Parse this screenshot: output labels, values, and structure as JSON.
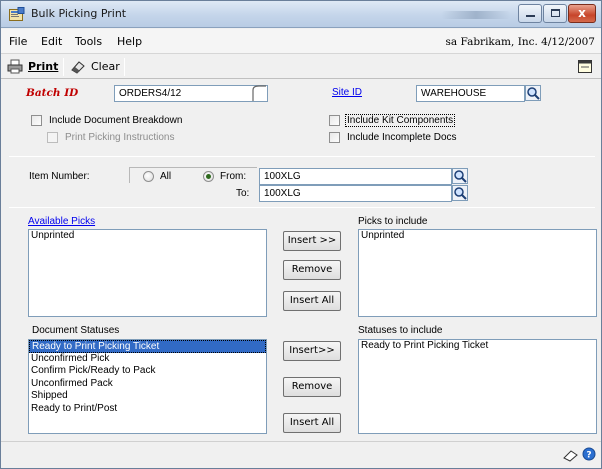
{
  "window": {
    "title": "Bulk Picking Print",
    "controls": [
      "minimize",
      "maximize",
      "close"
    ]
  },
  "menu": {
    "items": [
      "File",
      "Edit",
      "Tools",
      "Help"
    ],
    "context": "sa  Fabrikam, Inc.  4/12/2007"
  },
  "toolbar": {
    "print_label": "Print",
    "clear_label": "Clear"
  },
  "batch": {
    "label": "Batch ID",
    "value": "ORDERS4/12"
  },
  "site": {
    "label": "Site ID",
    "value": "WAREHOUSE"
  },
  "options": {
    "include_doc_breakdown": "Include Document Breakdown",
    "print_picking_instructions": "Print Picking Instructions",
    "include_kit_components": "Include Kit Components",
    "include_incomplete_docs": "Include Incomplete Docs"
  },
  "item_number": {
    "label": "Item Number:",
    "all_label": "All",
    "from_label": "From:",
    "to_label": "To:",
    "from_value": "100XLG",
    "to_value": "100XLG",
    "selected": "From"
  },
  "picks": {
    "available_label": "Available Picks",
    "available_items": [
      "Unprinted"
    ],
    "include_label": "Picks to include",
    "include_items": [
      "Unprinted"
    ],
    "insert_label": "Insert >>",
    "remove_label": "Remove",
    "insert_all_label": "Insert All"
  },
  "statuses": {
    "document_label": "Document Statuses",
    "document_items": [
      "Ready to Print Picking Ticket",
      "Unconfirmed Pick",
      "Confirm Pick/Ready to Pack",
      "Unconfirmed Pack",
      "Shipped",
      "Ready to Print/Post"
    ],
    "selected_index": 0,
    "include_label": "Statuses to include",
    "include_items": [
      "Ready to Print Picking Ticket"
    ],
    "insert_label": "Insert>>",
    "remove_label": "Remove",
    "insert_all_label": "Insert All"
  }
}
